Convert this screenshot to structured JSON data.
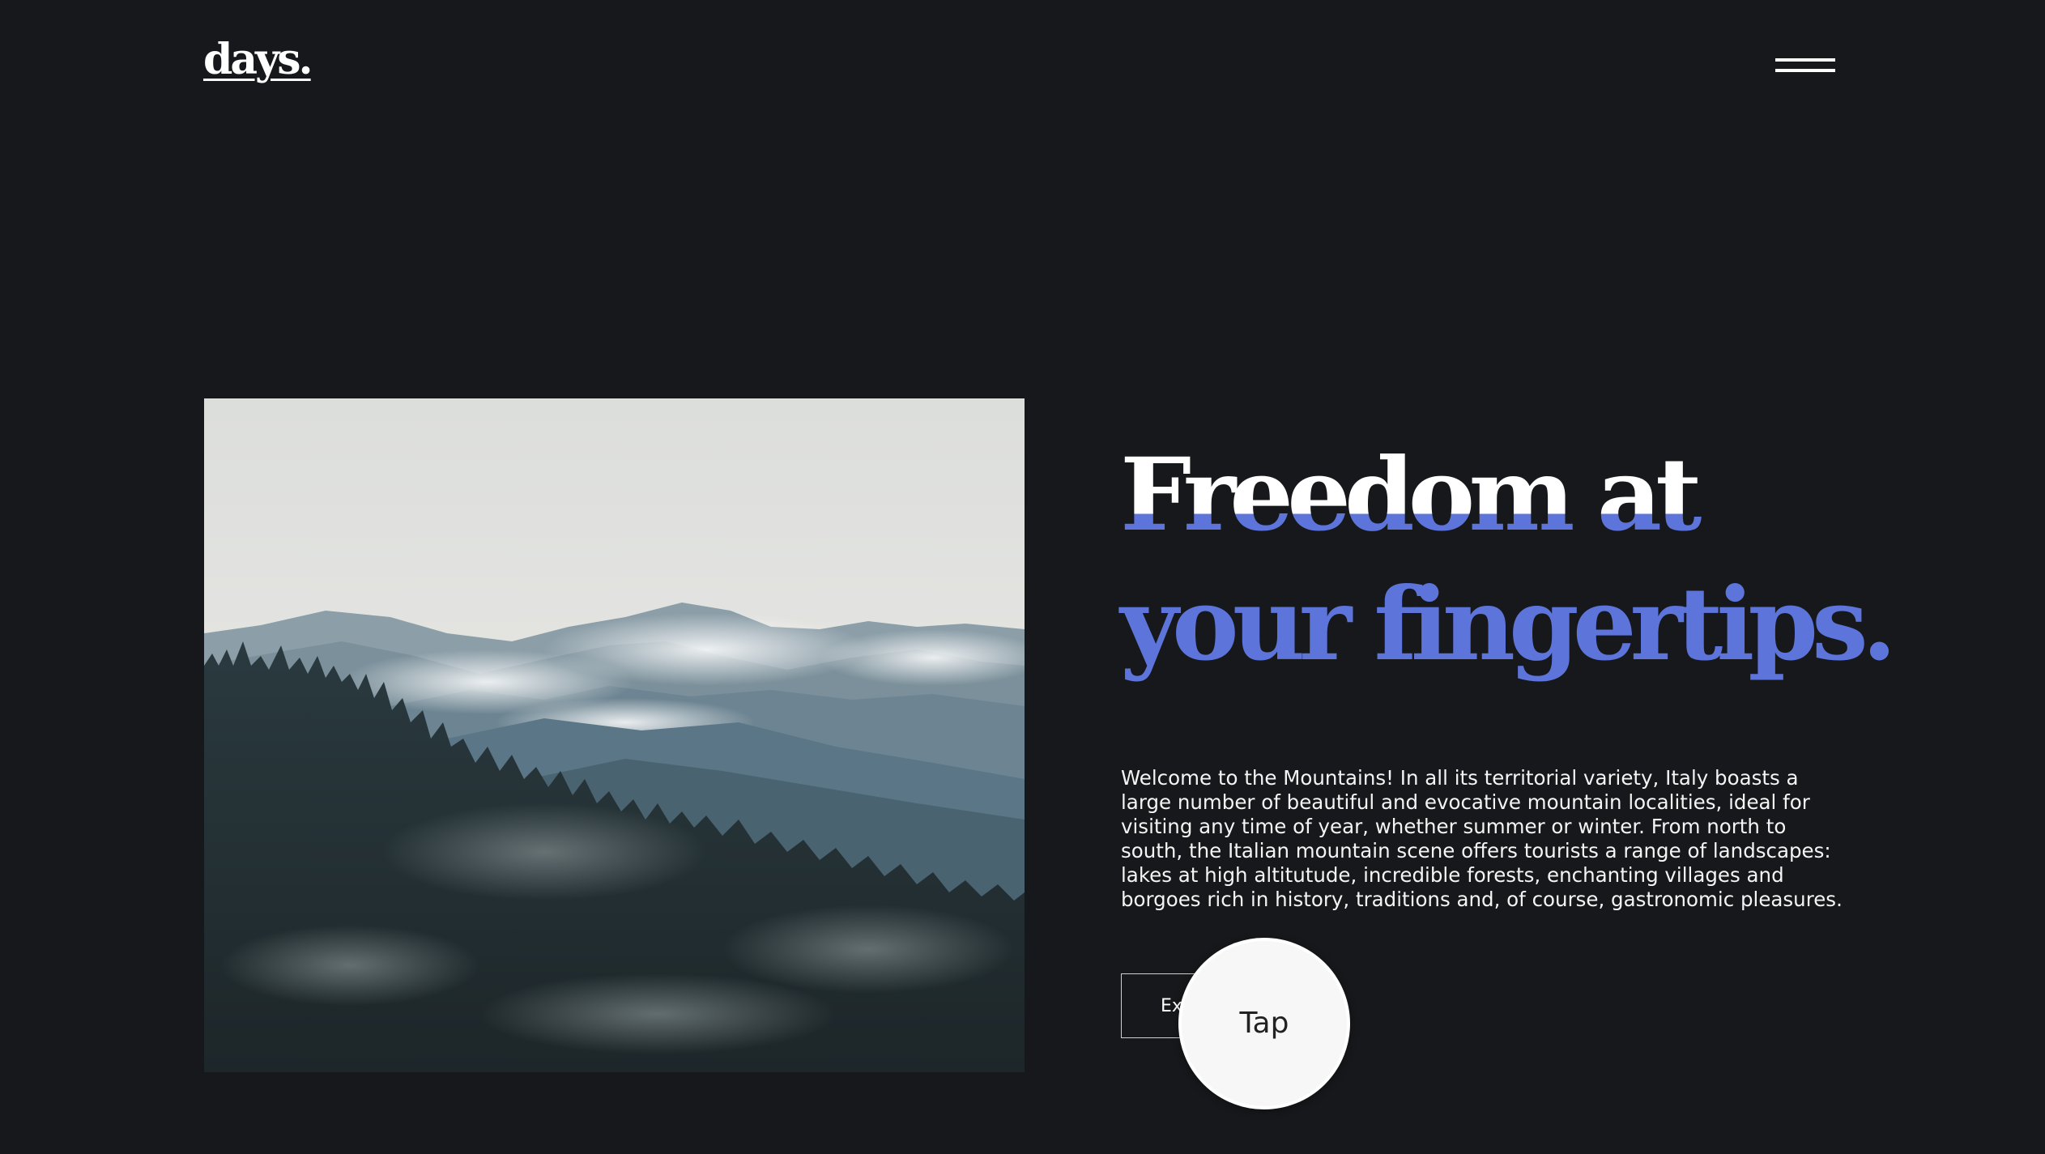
{
  "brand": {
    "logo_text": "days."
  },
  "nav": {
    "menu_icon": "hamburger-menu-icon"
  },
  "hero": {
    "image_description_icon": "mountain-forest-photo",
    "headline_line1": "Freedom at",
    "headline_line2": "your fingertips.",
    "body": "Welcome to the Mountains! In all its territorial variety, Italy boasts a large number of beautiful and evocative mountain localities, ideal for visiting any time of year, whether summer or winter. From north to south, the Italian mountain scene offers tourists a range of landscapes: lakes at high altitutude, incredible forests, enchanting villages and borgoes rich in history, traditions and, of course, gastronomic pleasures.",
    "button_label": "Explore"
  },
  "overlay": {
    "tap_label": "Tap"
  },
  "colors": {
    "background": "#17181b",
    "accent": "#5d74da",
    "text": "#ffffff"
  }
}
